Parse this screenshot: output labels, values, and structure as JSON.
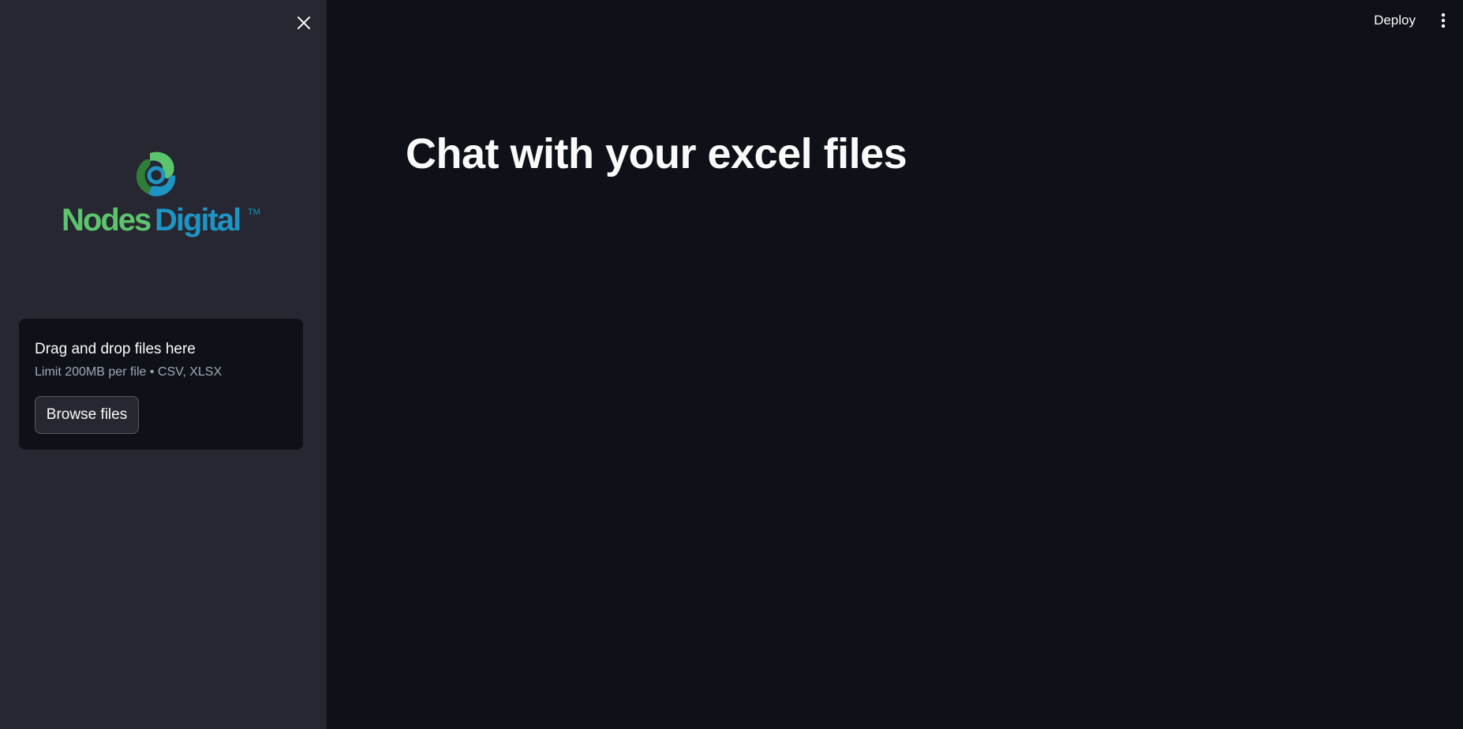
{
  "sidebar": {
    "close_icon": "close-icon",
    "logo": {
      "text_part1": "Nodes",
      "text_part2": "Digital",
      "trademark": "TM",
      "colors": {
        "green": "#5cc46e",
        "blue": "#1e94c4",
        "dark_green": "#2f7d3b"
      }
    },
    "uploader": {
      "title": "Drag and drop files here",
      "subtitle": "Limit 200MB per file • CSV, XLSX",
      "browse_label": "Browse files"
    }
  },
  "header": {
    "deploy_label": "Deploy",
    "menu_icon": "vertical-ellipsis-icon"
  },
  "main": {
    "title": "Chat with your excel files"
  },
  "colors": {
    "sidebar_bg": "#262730",
    "main_bg": "#0e1118",
    "text": "#fafafa",
    "muted_text": "#a3a8b4"
  }
}
